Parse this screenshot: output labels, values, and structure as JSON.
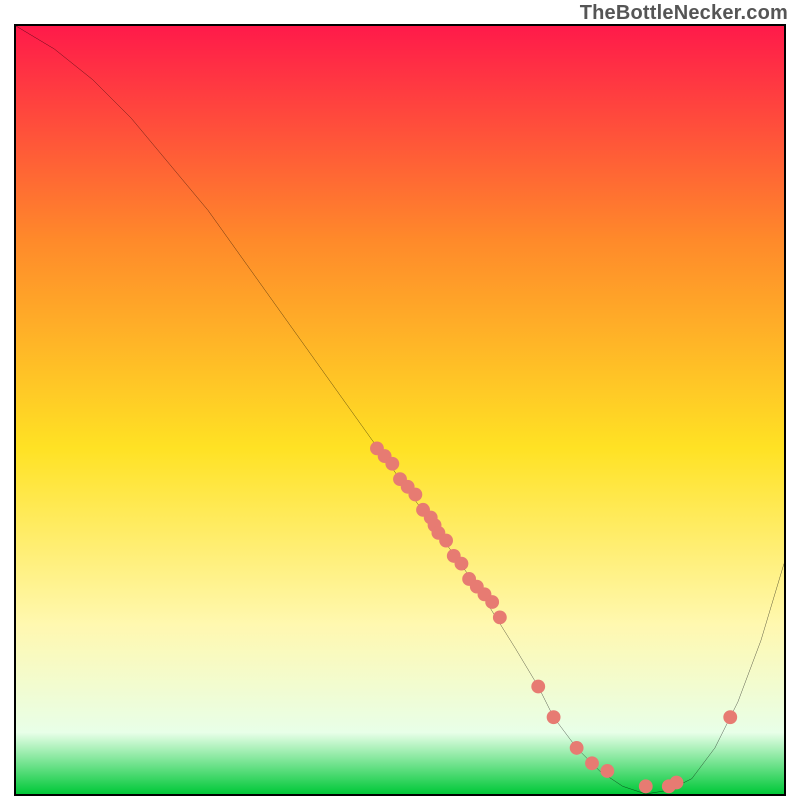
{
  "watermark": "TheBottleNecker.com",
  "colors": {
    "gradient_top": "#ff1a4a",
    "gradient_upper_mid": "#ff8a2a",
    "gradient_mid": "#ffe224",
    "gradient_lower_mid": "#fff8b0",
    "gradient_low": "#e8ffe8",
    "gradient_bottom": "#00c838",
    "curve": "#000000",
    "marker": "#e77b72"
  },
  "chart_data": {
    "type": "line",
    "title": "",
    "xlabel": "",
    "ylabel": "",
    "xlim": [
      0,
      100
    ],
    "ylim": [
      0,
      100
    ],
    "series": [
      {
        "name": "bottleneck-curve",
        "x": [
          0,
          5,
          10,
          15,
          20,
          25,
          30,
          35,
          40,
          45,
          50,
          55,
          60,
          65,
          68,
          70,
          73,
          76,
          79,
          82,
          85,
          88,
          91,
          94,
          97,
          100
        ],
        "y": [
          100,
          97,
          93,
          88,
          82,
          76,
          69,
          62,
          55,
          48,
          41,
          34,
          27,
          19,
          14,
          10,
          6,
          3,
          1,
          0,
          0.5,
          2,
          6,
          12,
          20,
          30
        ]
      }
    ],
    "markers": {
      "name": "highlighted-points",
      "x": [
        47,
        48,
        49,
        50,
        51,
        52,
        53,
        54,
        54.5,
        55,
        56,
        57,
        58,
        59,
        60,
        61,
        62,
        63,
        68,
        70,
        73,
        75,
        77,
        82,
        85,
        86,
        93
      ],
      "y": [
        45,
        44,
        43,
        41,
        40,
        39,
        37,
        36,
        35,
        34,
        33,
        31,
        30,
        28,
        27,
        26,
        25,
        23,
        14,
        10,
        6,
        4,
        3,
        1,
        1,
        1.5,
        10
      ]
    }
  }
}
